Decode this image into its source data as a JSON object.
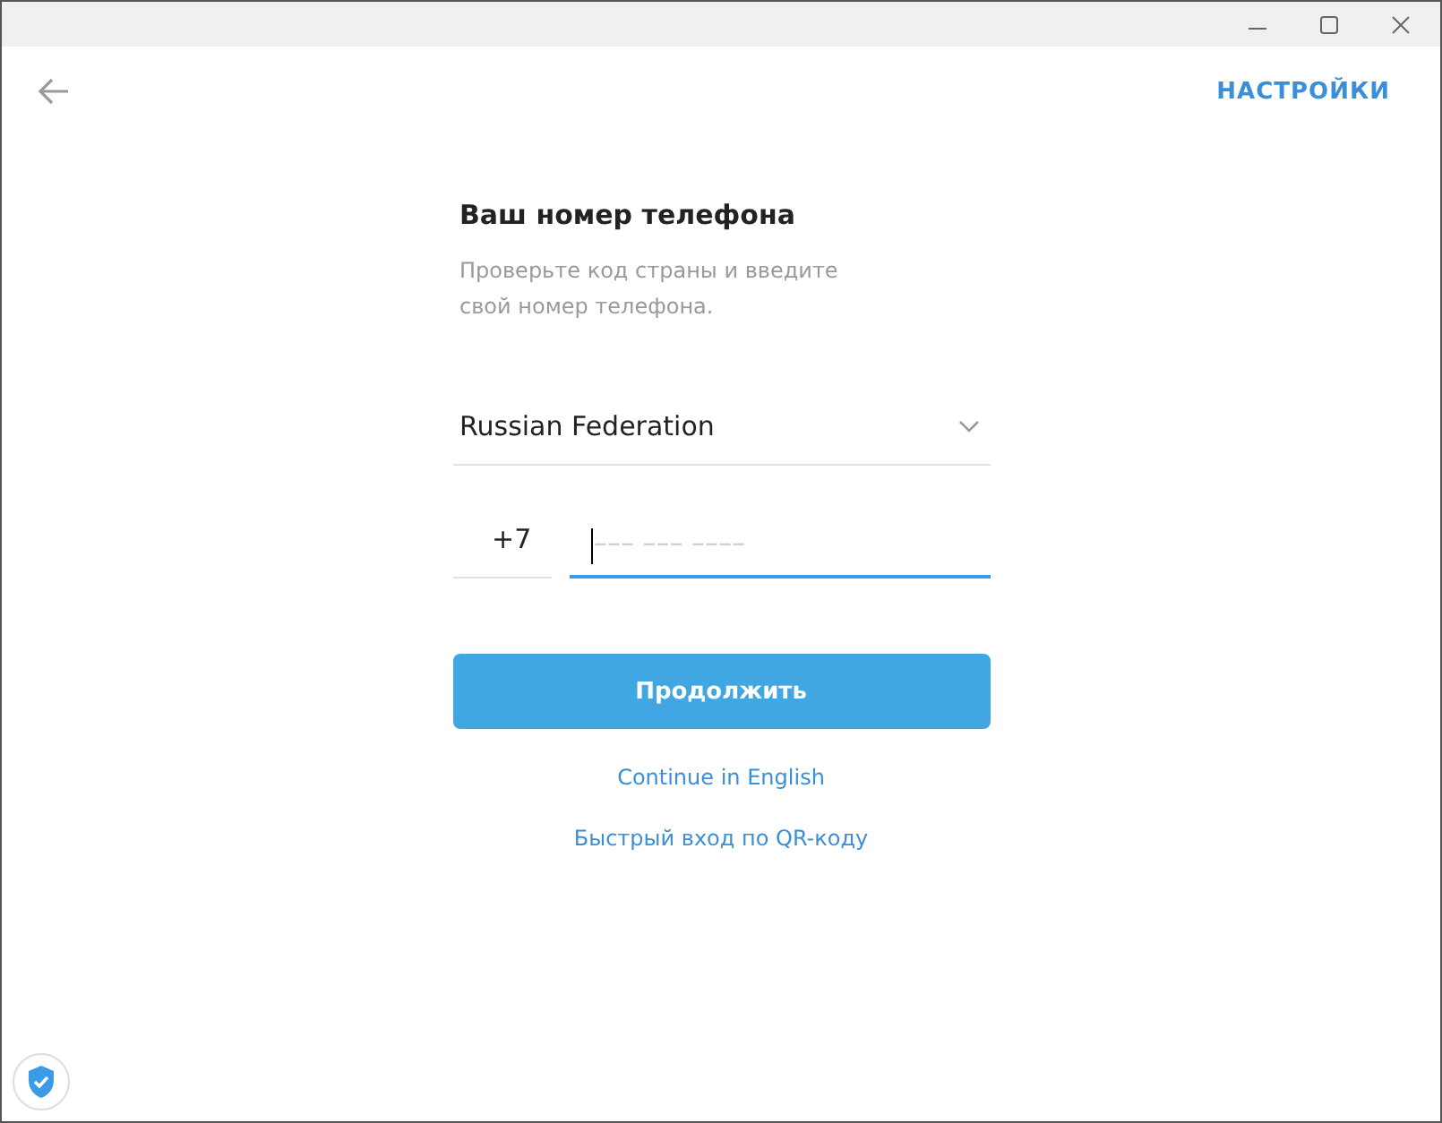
{
  "header": {
    "settings": "НАСТРОЙКИ"
  },
  "form": {
    "title": "Ваш номер телефона",
    "subtitle": "Проверьте код страны и введите свой номер телефона.",
    "country": "Russian Federation",
    "code": "+7",
    "phone_placeholder": "––– ––– ––––",
    "submit": "Продолжить",
    "links": [
      "Continue in English",
      "Быстрый вход по QR-коду"
    ]
  }
}
